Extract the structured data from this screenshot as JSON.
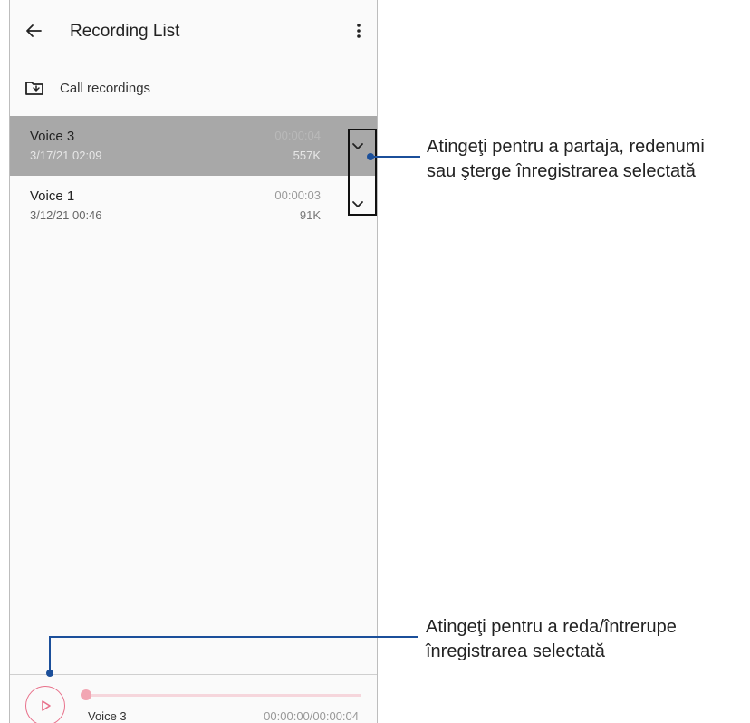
{
  "app_bar": {
    "title": "Recording List"
  },
  "folder": {
    "label": "Call recordings"
  },
  "recordings": [
    {
      "name": "Voice 3",
      "date": "3/17/21 02:09",
      "duration": "00:00:04",
      "size": "557K",
      "selected": true
    },
    {
      "name": "Voice 1",
      "date": "3/12/21 00:46",
      "duration": "00:00:03",
      "size": "91K",
      "selected": false
    }
  ],
  "player": {
    "now_playing": "Voice 3",
    "time": "00:00:00/00:00:04",
    "progress": 0
  },
  "callouts": {
    "options": {
      "line1": "Atingeţi pentru a partaja, redenumi",
      "line2": "sau şterge înregistrarea selectată"
    },
    "play": {
      "line1": "Atingeţi pentru a reda/întrerupe",
      "line2": "înregistrarea selectată"
    }
  },
  "colors": {
    "accent": "#e8708a",
    "selected_row": "#a8a8a8",
    "callout_line": "#1b4f9a"
  },
  "icons": {
    "back": "arrow-left-icon",
    "more": "more-vert-icon",
    "folder": "folder-call-icon",
    "expand": "chevron-down-icon",
    "play": "play-icon"
  }
}
